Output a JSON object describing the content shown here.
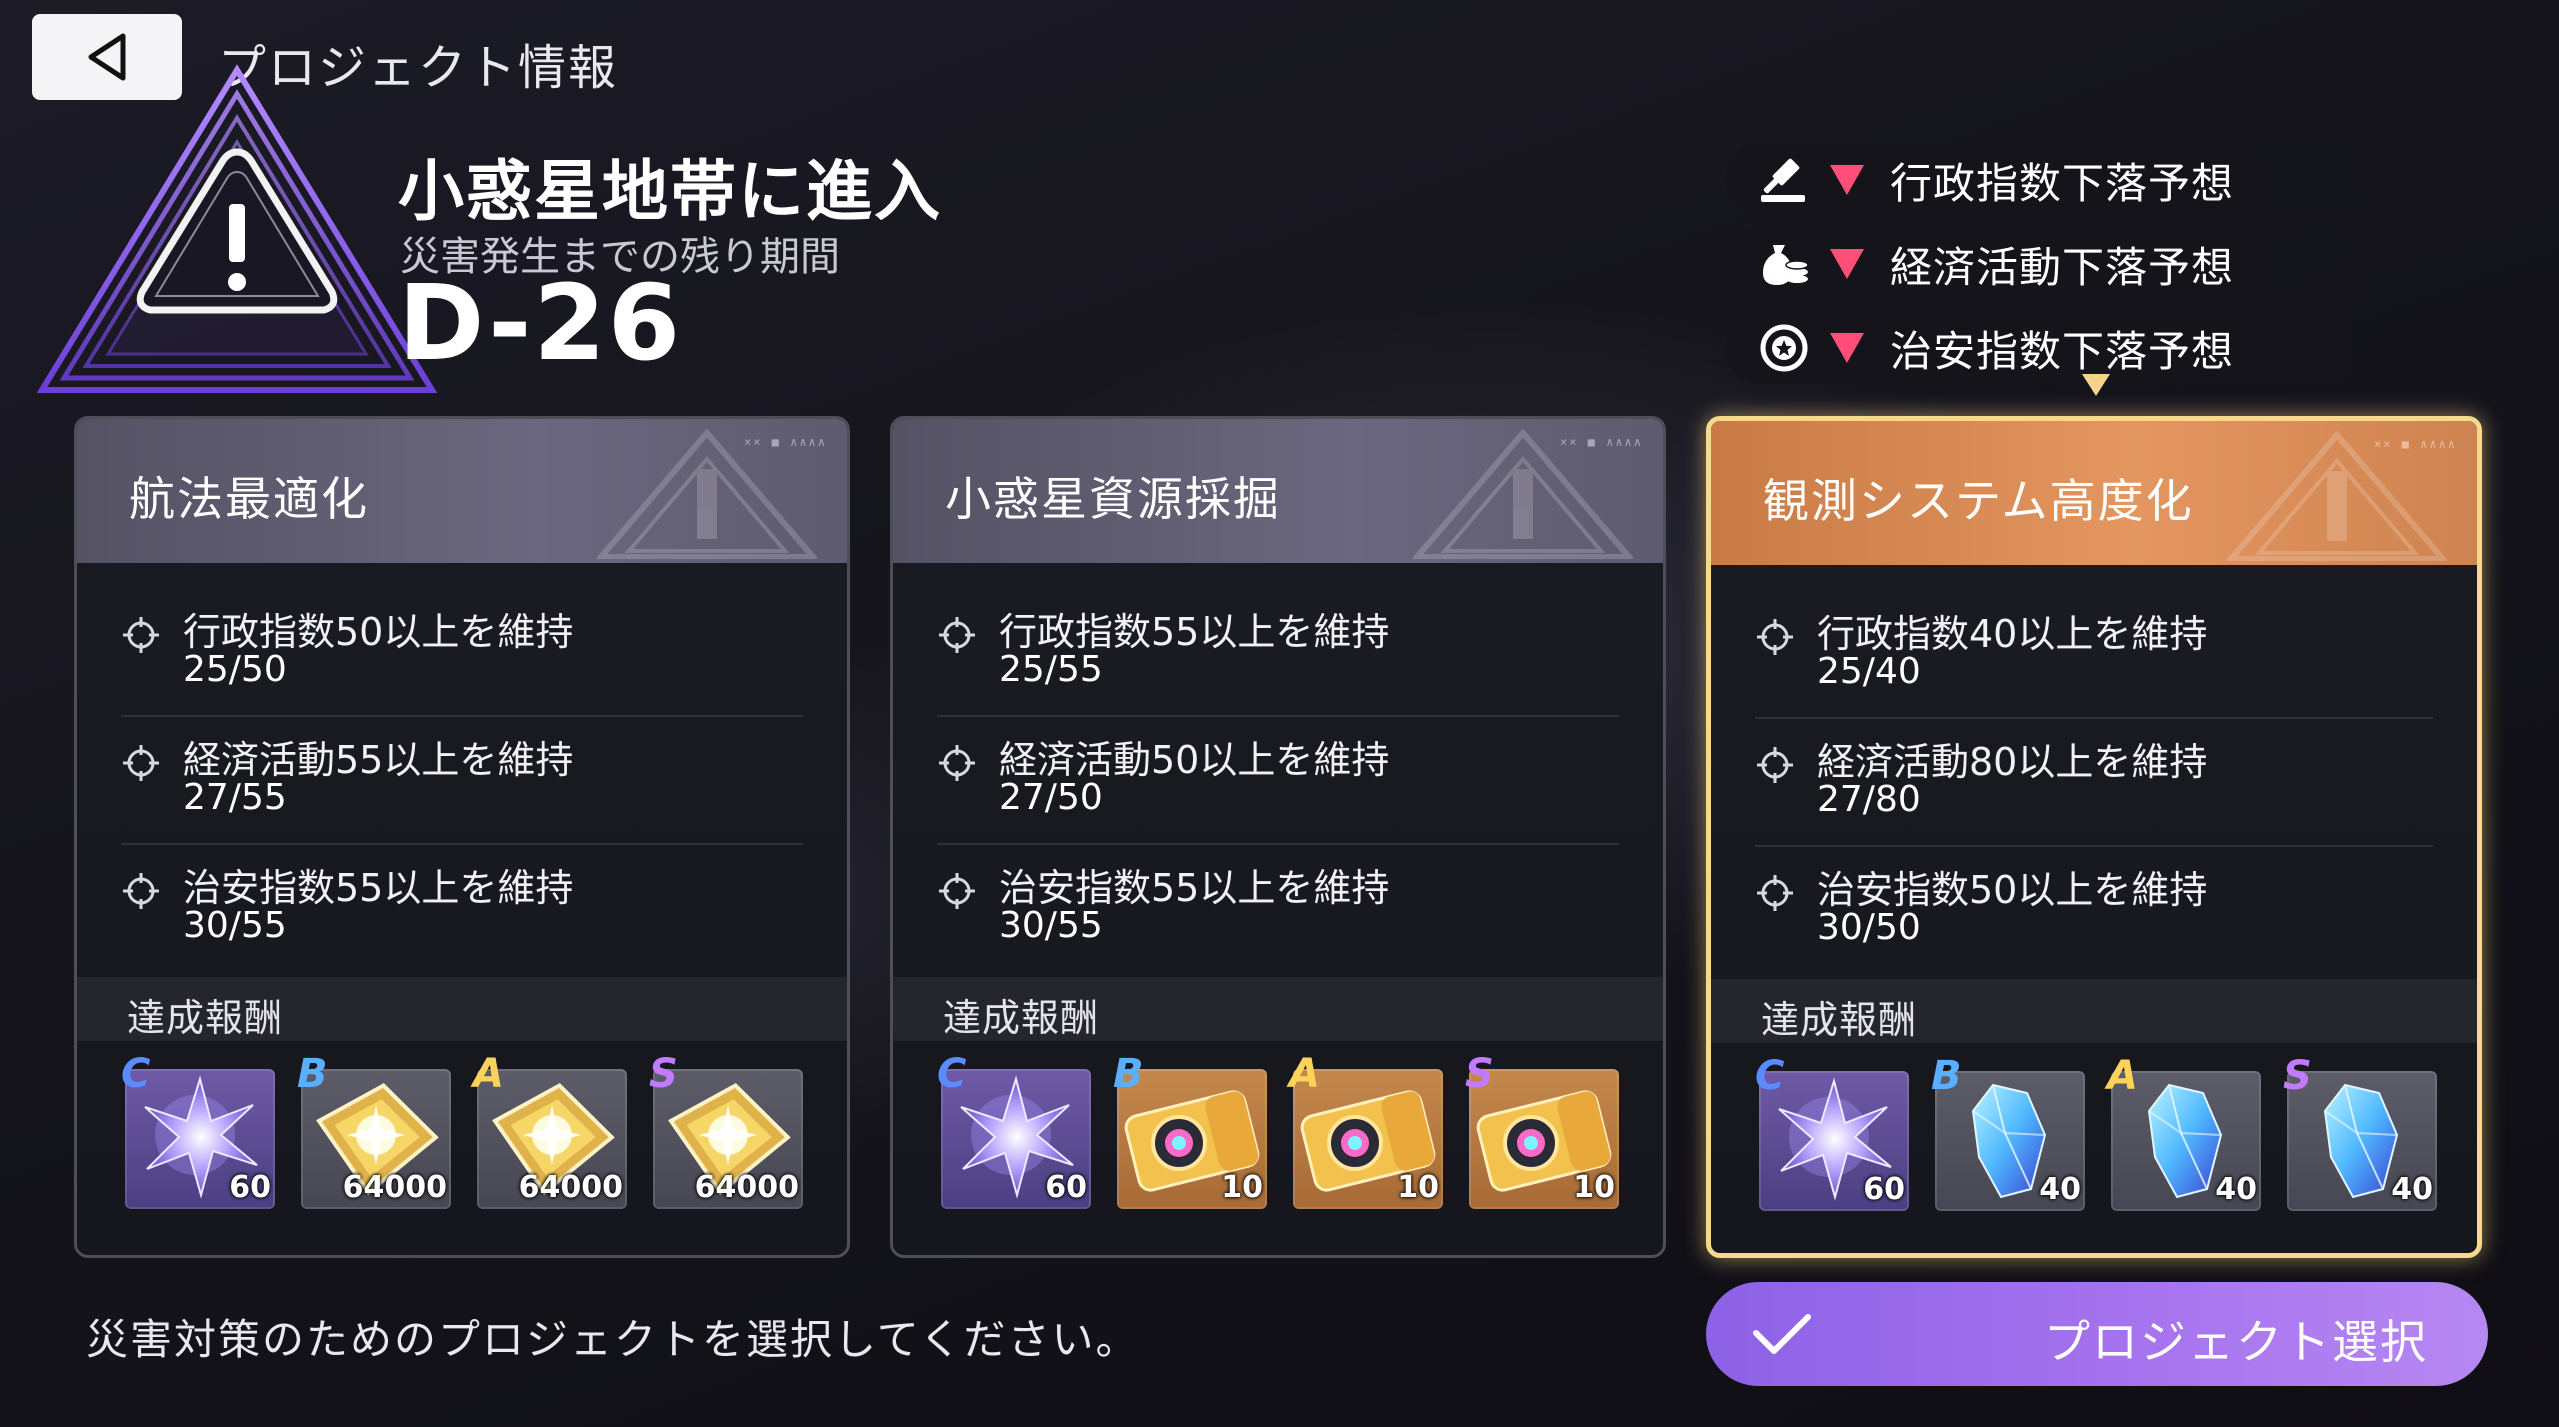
{
  "header": {
    "title": "プロジェクト情報",
    "back_icon": "back-triangle-icon"
  },
  "event": {
    "title": "小惑星地帯に進入",
    "subtitle": "災害発生までの残り期間",
    "countdown": "D-26"
  },
  "forecasts": [
    {
      "icon": "gavel-icon",
      "text": "行政指数下落予想"
    },
    {
      "icon": "money-bag-icon",
      "text": "経済活動下落予想"
    },
    {
      "icon": "badge-icon",
      "text": "治安指数下落予想"
    }
  ],
  "projects": [
    {
      "title": "航法最適化",
      "selected": false,
      "conditions": [
        {
          "text": "行政指数50以上を維持",
          "progress": "25/50"
        },
        {
          "text": "経済活動55以上を維持",
          "progress": "27/55"
        },
        {
          "text": "治安指数55以上を維持",
          "progress": "30/55"
        }
      ],
      "reward_label": "達成報酬",
      "rewards": [
        {
          "grade": "C",
          "item": "star-crystal",
          "qty": "60"
        },
        {
          "grade": "B",
          "item": "gold-chip",
          "qty": "64000"
        },
        {
          "grade": "A",
          "item": "gold-chip",
          "qty": "64000"
        },
        {
          "grade": "S",
          "item": "gold-chip",
          "qty": "64000"
        }
      ]
    },
    {
      "title": "小惑星資源採掘",
      "selected": false,
      "conditions": [
        {
          "text": "行政指数55以上を維持",
          "progress": "25/55"
        },
        {
          "text": "経済活動50以上を維持",
          "progress": "27/50"
        },
        {
          "text": "治安指数55以上を維持",
          "progress": "30/55"
        }
      ],
      "reward_label": "達成報酬",
      "rewards": [
        {
          "grade": "C",
          "item": "star-crystal",
          "qty": "60"
        },
        {
          "grade": "B",
          "item": "ticket",
          "qty": "10"
        },
        {
          "grade": "A",
          "item": "ticket",
          "qty": "10"
        },
        {
          "grade": "S",
          "item": "ticket",
          "qty": "10"
        }
      ]
    },
    {
      "title": "観測システム高度化",
      "selected": true,
      "conditions": [
        {
          "text": "行政指数40以上を維持",
          "progress": "25/40"
        },
        {
          "text": "経済活動80以上を維持",
          "progress": "27/80"
        },
        {
          "text": "治安指数50以上を維持",
          "progress": "30/50"
        }
      ],
      "reward_label": "達成報酬",
      "rewards": [
        {
          "grade": "C",
          "item": "star-crystal",
          "qty": "60"
        },
        {
          "grade": "B",
          "item": "blue-crystal",
          "qty": "40"
        },
        {
          "grade": "A",
          "item": "blue-crystal",
          "qty": "40"
        },
        {
          "grade": "S",
          "item": "blue-crystal",
          "qty": "40"
        }
      ]
    }
  ],
  "footer": {
    "note": "災害対策のためのプロジェクトを選択してください。",
    "select_label": "プロジェクト選択"
  },
  "colors": {
    "grade_C": "#5b8cff",
    "grade_B": "#5ab0ff",
    "grade_A": "#ffd35a",
    "grade_S": "#c27bff",
    "down_arrow": "#ff4f78",
    "selected_border": "#f6d98a",
    "select_button": "#a673ee"
  }
}
